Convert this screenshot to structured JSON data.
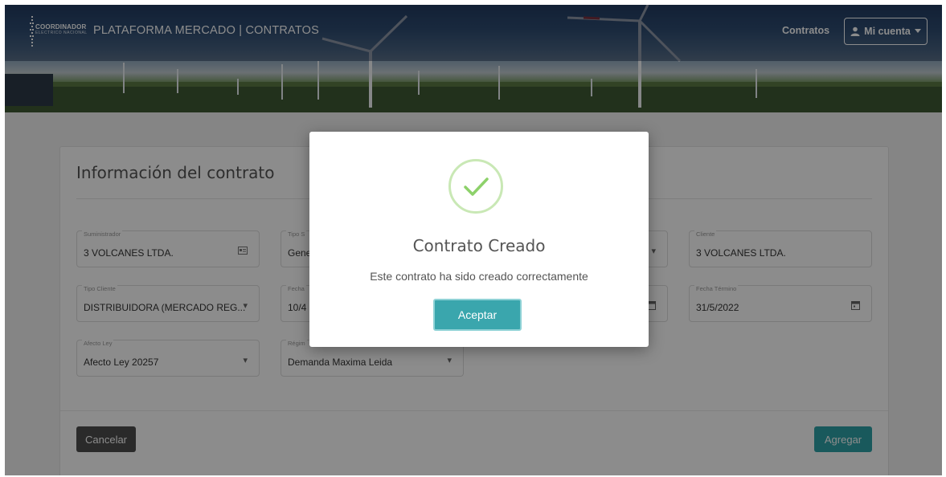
{
  "header": {
    "brand_small": "COORDINADOR",
    "brand_sub": "ELECTRICO NACIONAL",
    "app_title": "PLATAFORMA MERCADO | CONTRATOS",
    "nav_contratos": "Contratos",
    "account_label": "Mi cuenta",
    "account_icon": "user-icon",
    "caret_icon": "caret-down-icon"
  },
  "form": {
    "title": "Información del contrato",
    "fields": [
      {
        "label": "Suministrador",
        "value": "3 VOLCANES LTDA.",
        "icon": "id-card-icon"
      },
      {
        "label": "Tipo S",
        "value": "Gene",
        "icon": ""
      },
      {
        "label": "",
        "value": "",
        "icon": "caret-down-icon"
      },
      {
        "label": "Cliente",
        "value": "3 VOLCANES LTDA.",
        "icon": ""
      },
      {
        "label": "Tipo Cliente",
        "value": "DISTRIBUIDORA (MERCADO REG...",
        "icon": "caret-down-icon"
      },
      {
        "label": "Fecha",
        "value": "10/4",
        "icon": ""
      },
      {
        "label": "",
        "value": "",
        "icon": "calendar-icon"
      },
      {
        "label": "Fecha Término",
        "value": "31/5/2022",
        "icon": "calendar-icon"
      },
      {
        "label": "Afecto Ley",
        "value": "Afecto Ley 20257",
        "icon": "caret-down-icon"
      },
      {
        "label": "Régim",
        "value": "Demanda Maxima Leida",
        "icon": "caret-down-icon"
      }
    ],
    "cancel_label": "Cancelar",
    "add_label": "Agregar"
  },
  "modal": {
    "icon": "check-icon",
    "title": "Contrato Creado",
    "message": "Este contrato ha sido creado correctamente",
    "button_label": "Aceptar"
  },
  "colors": {
    "accent": "#2fa3a8",
    "success_ring": "#c9e8b5",
    "success_check": "#8dd16a",
    "dark_button": "#4d4d4d"
  }
}
